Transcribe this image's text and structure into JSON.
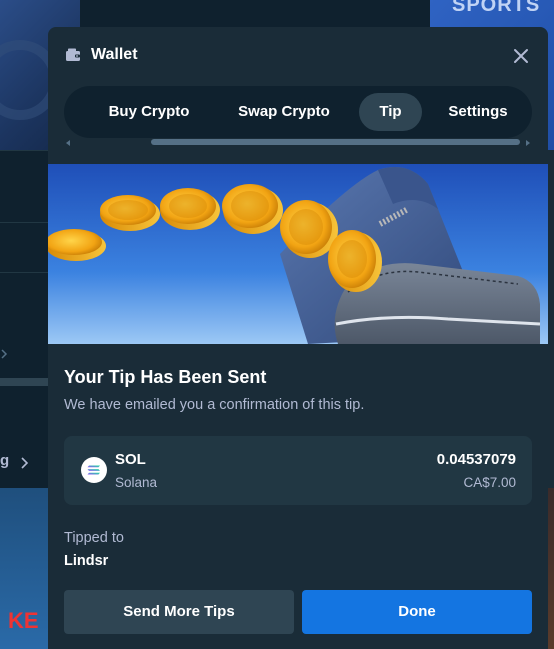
{
  "background": {
    "sports_text": "SPORTS",
    "nav_text": "g",
    "bottom_text": "KE"
  },
  "modal": {
    "title": "Wallet",
    "tabs": [
      {
        "label": "Buy Crypto",
        "active": false
      },
      {
        "label": "Swap Crypto",
        "active": false
      },
      {
        "label": "Tip",
        "active": true
      },
      {
        "label": "Settings",
        "active": false
      }
    ]
  },
  "result": {
    "title": "Your Tip Has Been Sent",
    "subtitle": "We have emailed you a confirmation of this tip."
  },
  "coin": {
    "symbol": "SOL",
    "name": "Solana",
    "amount": "0.04537079",
    "fiat": "CA$7.00",
    "icon": "solana-icon"
  },
  "recipient": {
    "label": "Tipped to",
    "name": "Lindsr"
  },
  "actions": {
    "secondary": "Send More Tips",
    "primary": "Done"
  },
  "colors": {
    "modal_bg": "#1a2c38",
    "card_bg": "#213743",
    "tab_active": "#2f4553",
    "primary_button": "#1475e1",
    "secondary_button": "#2f4553",
    "muted_text": "#b1bad3"
  }
}
